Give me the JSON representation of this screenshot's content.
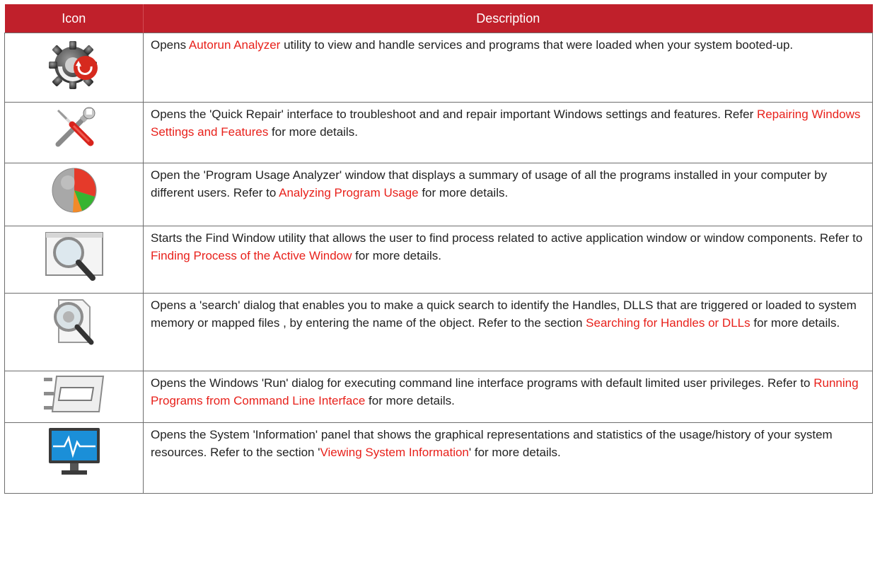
{
  "headers": {
    "icon": "Icon",
    "description": "Description"
  },
  "rows": [
    {
      "icon": "autorun-gear-icon",
      "pre": "Opens ",
      "link": "Autorun Analyzer",
      "post": " utility to view and handle services and programs that were loaded when your system booted-up."
    },
    {
      "icon": "tools-wrench-screwdriver-icon",
      "pre": "Opens the 'Quick Repair' interface  to troubleshoot and and repair important Windows settings and features. Refer ",
      "link": "Repairing Windows Settings and Features",
      "post": " for more details."
    },
    {
      "icon": "pie-chart-icon",
      "pre": "Open the 'Program Usage Analyzer' window that displays a summary of usage of all the programs installed in your computer by different users. Refer to ",
      "link": "Analyzing Program Usage",
      "post": " for more details."
    },
    {
      "icon": "find-window-magnifier-icon",
      "pre": "Starts the Find Window utility that allows the user to find process related to active application window or window components. Refer to ",
      "link": "Finding Process of the Active Window",
      "post": " for more details."
    },
    {
      "icon": "search-file-magnifier-icon",
      "pre": "Opens a 'search' dialog that enables you to make a quick search to identify the Handles, DLLS that are triggered or loaded to system memory or mapped files , by entering the name of the object. Refer to  the section ",
      "link": "Searching for Handles or DLLs",
      "post": " for more details."
    },
    {
      "icon": "run-dialog-icon",
      "pre": "Opens the Windows 'Run' dialog for executing command line interface programs with default limited user privileges. Refer to ",
      "link": "Running Programs from Command Line Interface",
      "post": " for more details."
    },
    {
      "icon": "system-monitor-icon",
      "pre": "Opens the System 'Information' panel that shows the graphical representations and statistics of the usage/history of your system resources. Refer to the section '",
      "link": "Viewing System Information",
      "post": "' for more details."
    }
  ],
  "colors": {
    "header_bg": "#c0202b",
    "link": "#e8211b",
    "border": "#6e6e6e"
  }
}
